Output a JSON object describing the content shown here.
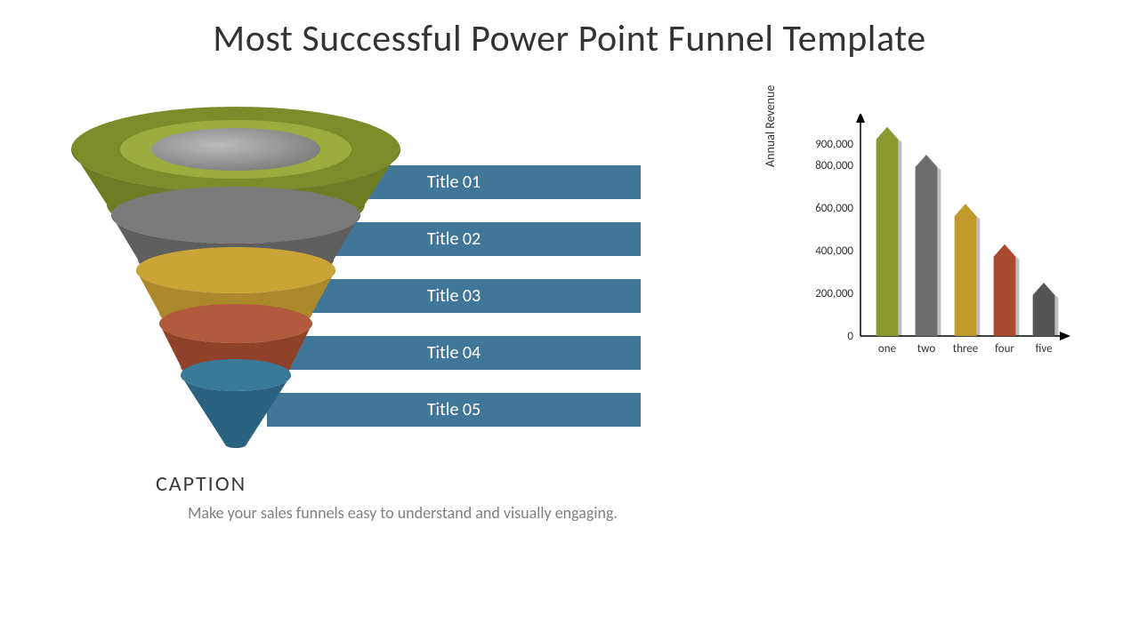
{
  "title": "Most Successful Power Point Funnel Template",
  "funnel": {
    "labels": [
      "Title 01",
      "Title 02",
      "Title 03",
      "Title 04",
      "Title 05"
    ],
    "colors": [
      "#8a9a2f",
      "#6d6d6d",
      "#c29a2c",
      "#a84a2e",
      "#2f6e8c"
    ]
  },
  "caption": {
    "heading": "CAPTION",
    "body": "Make your sales funnels easy to understand and visually engaging."
  },
  "chart_data": {
    "type": "bar",
    "title": "",
    "ylabel": "Annual Revenue",
    "xlabel": "",
    "ylim": [
      0,
      1000000
    ],
    "ticks": [
      0,
      200000,
      400000,
      600000,
      800000,
      900000
    ],
    "tick_labels": [
      "0",
      "200,000",
      "400,000",
      "600,000",
      "800,000",
      "900,000"
    ],
    "categories": [
      "one",
      "two",
      "three",
      "four",
      "five"
    ],
    "values": [
      980000,
      850000,
      620000,
      430000,
      250000
    ],
    "colors": [
      "#8a9a2f",
      "#6d6d6d",
      "#c29a2c",
      "#a84a2e",
      "#555555"
    ]
  }
}
